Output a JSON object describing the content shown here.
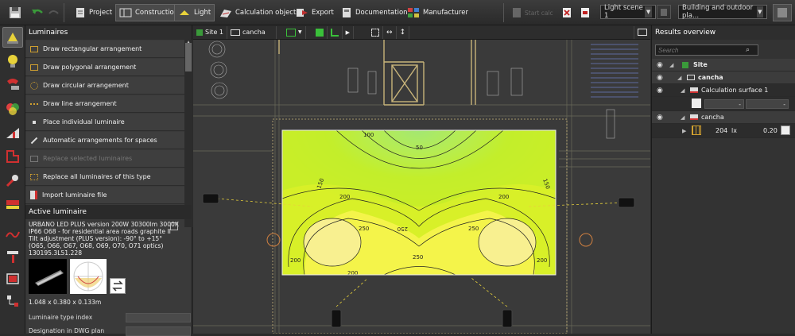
{
  "toolbar": {
    "project": "Project",
    "construction": "Construction",
    "light": "Light",
    "calc_objects": "Calculation objects",
    "export": "Export",
    "documentation": "Documentation",
    "manufacturer": "Manufacturer",
    "start_calc": "Start calc",
    "light_scene": "Light scene 1",
    "view_mode": "Building and outdoor pla..."
  },
  "luminaires": {
    "title": "Luminaires",
    "items": [
      "Draw rectangular arrangement",
      "Draw polygonal arrangement",
      "Draw circular arrangement",
      "Draw line arrangement",
      "Place individual luminaire",
      "Automatic arrangements for spaces",
      "Replace selected luminaires",
      "Replace all luminaires of this type",
      "Import luminaire file"
    ]
  },
  "active_luminaire": {
    "title": "Active luminaire",
    "lines": [
      "URBANO LED PLUS version 200W 30300lm 3000K",
      "IP66 O68 - for residential area roads graphite II",
      "Tilt adjustment (PLUS version): -90° to +15°",
      "(O65, O66, O67, O68, O69, O70, O71 optics)",
      "130195.3L51.228"
    ],
    "dimensions": "1.048 x 0.380 x 0.133m",
    "type_index_label": "Luminaire type index",
    "designation_label": "Designation in DWG plan"
  },
  "canvas": {
    "site_tab": "Site 1",
    "cancha_tab": "cancha",
    "isolines": [
      "50",
      "100",
      "150",
      "150",
      "200",
      "200",
      "250",
      "250",
      "250",
      "250",
      "200",
      "200",
      "200"
    ]
  },
  "results": {
    "title": "Results overview",
    "search_placeholder": "Search",
    "site": "Site",
    "cancha": "cancha",
    "calc_surface": "Calculation surface 1",
    "dash1": "-",
    "dash2": "-",
    "cancha2": "cancha",
    "value": "204",
    "unit": "lx",
    "ratio": "0.20"
  }
}
